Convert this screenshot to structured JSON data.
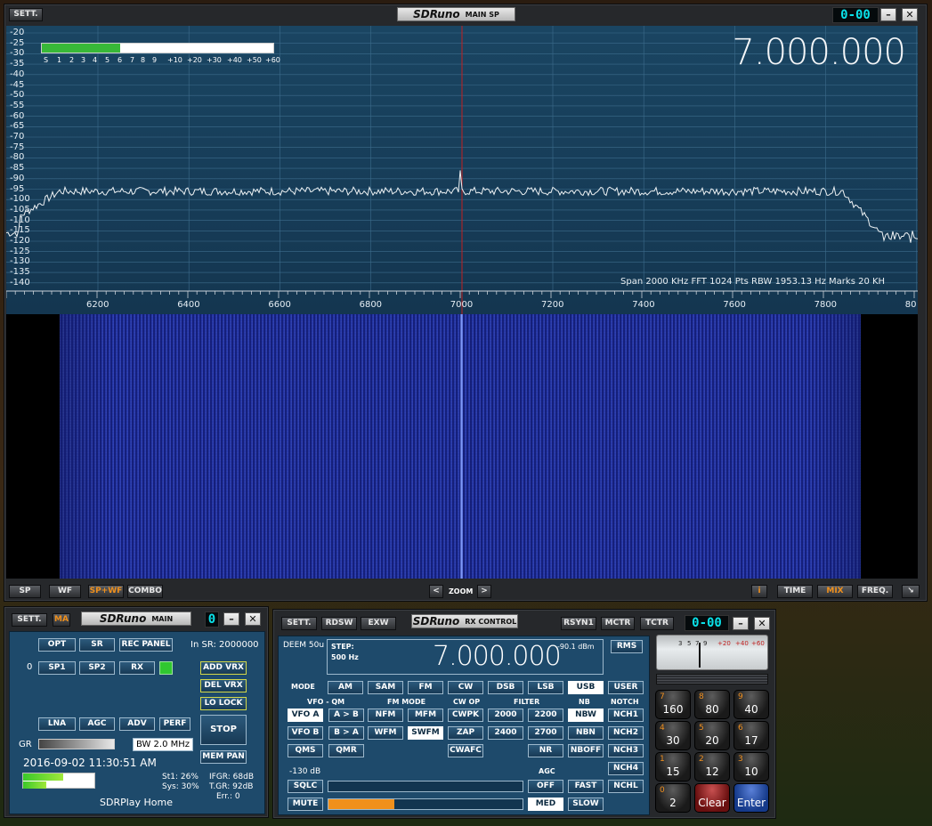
{
  "main_sp": {
    "sett": "SETT.",
    "badge_logo": "SDRuno",
    "badge_title": "MAIN SP",
    "clock": "0-00",
    "frequency": "7.000.000",
    "y_labels": [
      "-20",
      "-25",
      "-30",
      "-35",
      "-40",
      "-45",
      "-50",
      "-55",
      "-60",
      "-65",
      "-70",
      "-75",
      "-80",
      "-85",
      "-90",
      "-95",
      "-100",
      "-105",
      "-110",
      "-115",
      "-120",
      "-125",
      "-130",
      "-135",
      "-140"
    ],
    "x_labels": [
      "6200",
      "6400",
      "6600",
      "6800",
      "7000",
      "7200",
      "7400",
      "7600",
      "7800",
      "80"
    ],
    "smeter_labels": [
      "S",
      "1",
      "2",
      "3",
      "4",
      "5",
      "6",
      "7",
      "8",
      "9",
      "+10",
      "+20",
      "+30",
      "+40",
      "+50",
      "+60"
    ],
    "smeter_level": 0.34,
    "info": "Span 2000 KHz   FFT 1024 Pts   RBW 1953.13 Hz   Marks 20 KH",
    "bottom_buttons": {
      "sp": "SP",
      "wf": "WF",
      "spwf": "SP+WF",
      "combo": "COMBO"
    },
    "zoom_prev": "<",
    "zoom": "ZOOM",
    "zoom_next": ">",
    "right_buttons": {
      "info": "i",
      "time": "TIME",
      "mix": "MIX",
      "freq": "FREQ."
    }
  },
  "main": {
    "sett": "SETT.",
    "ma": "MA",
    "badge_logo": "SDRuno",
    "badge_title": "MAIN",
    "digit": "0",
    "buttons": {
      "opt": "OPT",
      "sr": "SR",
      "rec_panel": "REC PANEL",
      "sp1": "SP1",
      "sp2": "SP2",
      "rx": "RX",
      "add_vrx": "ADD VRX",
      "del_vrx": "DEL VRX",
      "lo_lock": "LO LOCK",
      "lna": "LNA",
      "agc": "AGC",
      "adv": "ADV",
      "perf": "PERF",
      "stop": "STOP",
      "mem_pan": "MEM PAN"
    },
    "in_sr": "In SR: 2000000",
    "row_num": "0",
    "gr": "GR",
    "bw": "BW 2.0 MHz",
    "datetime": "2016-09-02 11:30:51 AM",
    "st1": "St1: 26%",
    "sys": "Sys: 30%",
    "ifgr": "IFGR: 68dB",
    "tgr": "T.GR: 92dB",
    "err": "Err.: 0",
    "home": "SDRPlay Home"
  },
  "rx": {
    "sett": "SETT.",
    "rdsw": "RDSW",
    "exw": "EXW",
    "badge_logo": "SDRuno",
    "badge_title": "RX CONTROL",
    "rsyn1": "RSYN1",
    "mctr": "MCTR",
    "tctr": "TCTR",
    "clock": "0-00",
    "deem": "DEEM 50u",
    "step": "STEP:",
    "step_val": "500 Hz",
    "frequency": "7.000.000",
    "dbm": "-90.1 dBm",
    "rms": "RMS",
    "mode_lbl": "MODE",
    "modes": [
      "AM",
      "SAM",
      "FM",
      "CW",
      "DSB",
      "LSB",
      "USB",
      "USER"
    ],
    "section_labels": {
      "vfo": "VFO - QM",
      "fm": "FM MODE",
      "cw": "CW OP",
      "filter": "FILTER",
      "nb": "NB",
      "notch": "NOTCH"
    },
    "vfo": [
      "VFO A",
      "A > B",
      "VFO B",
      "B > A",
      "QMS",
      "QMR"
    ],
    "fm": [
      "NFM",
      "MFM",
      "WFM",
      "SWFM"
    ],
    "cw": [
      "CWPK",
      "ZAP",
      "CWAFC"
    ],
    "filter": [
      "2000",
      "2200",
      "2400",
      "2700",
      "NR"
    ],
    "nb": [
      "NBW",
      "NBN",
      "NBOFF"
    ],
    "notch": [
      "NCH1",
      "NCH2",
      "NCH3",
      "NCH4",
      "NCHL"
    ],
    "level": "-130 dB",
    "agc_lbl": "AGC",
    "sqlc": "SQLC",
    "mute": "MUTE",
    "agc": [
      "OFF",
      "FAST",
      "MED",
      "SLOW"
    ],
    "volume_level": 0.34,
    "smeter_scale": [
      "3",
      "5",
      "7",
      "9",
      "+20",
      "+40",
      "+60"
    ],
    "keypad": [
      {
        "d": "7",
        "v": "160"
      },
      {
        "d": "8",
        "v": "80"
      },
      {
        "d": "9",
        "v": "40"
      },
      {
        "d": "4",
        "v": "30"
      },
      {
        "d": "5",
        "v": "20"
      },
      {
        "d": "6",
        "v": "17"
      },
      {
        "d": "1",
        "v": "15"
      },
      {
        "d": "2",
        "v": "12"
      },
      {
        "d": "3",
        "v": "10"
      },
      {
        "d": "0",
        "v": "2"
      },
      {
        "d": "",
        "v": "Clear"
      },
      {
        "d": "",
        "v": "Enter"
      }
    ]
  },
  "colors": {
    "panel": "#1e4a6b",
    "spectrum_bg": "#14364f",
    "waterfall": "#0e1a5a",
    "accent_orange": "#f0901c",
    "green": "#38c838",
    "cyan_digits": "#0ae0e8"
  }
}
